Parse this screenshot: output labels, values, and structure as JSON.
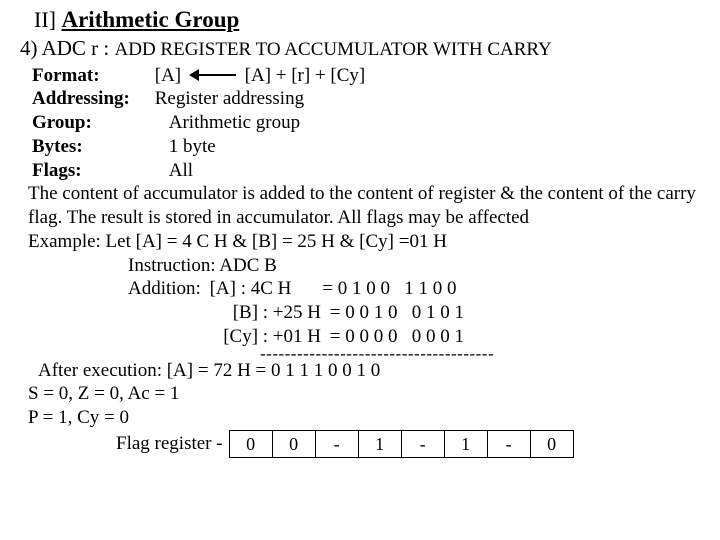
{
  "heading": {
    "label": "II]",
    "text": "Arithmetic Group"
  },
  "sub": {
    "num": "4)",
    "mnemonic": "ADC r :",
    "desc": "ADD REGISTER TO ACCUMULATOR WITH CARRY"
  },
  "format": {
    "label": "Format:",
    "lhs": "[A]",
    "rhs": "[A] + [r] + [Cy]"
  },
  "addressing": {
    "label": "Addressing:",
    "value": "Register  addressing"
  },
  "group": {
    "label": "Group:",
    "value": "Arithmetic group"
  },
  "bytes": {
    "label": "Bytes:",
    "value": "1 byte"
  },
  "flags": {
    "label": "Flags:",
    "value": "All"
  },
  "description": "The content of accumulator is added to the content of register & the content of the carry flag. The result is stored in accumulator. All flags may be affected",
  "example": {
    "let": "Example: Let [A] = 4 C H   &   [B] = 25 H    &    [Cy] =01 H",
    "instruction": "Instruction: ADC B",
    "addition_label": "Addition:",
    "row_a_lbl": "[A] :  4C H",
    "row_a_bin": "= 0 1 0 0   1 1 0 0",
    "row_b_lbl": "[B] : +25 H",
    "row_b_bin": "= 0 0 1 0   0 1 0 1",
    "row_c_lbl": "[Cy] : +01 H",
    "row_c_bin": "= 0 0 0 0   0 0 0 1",
    "dashes": "--------------------------------------",
    "after": "After execution: [A] = 72 H =  0 1 1 1   0 0 1 0",
    "flags_line1": "S = 0, Z = 0, Ac = 1",
    "flags_line2": "P = 1, Cy = 0",
    "flag_reg_label": "Flag register -",
    "flag_cells": [
      "0",
      "0",
      "-",
      "1",
      "-",
      "1",
      "-",
      "0"
    ]
  }
}
